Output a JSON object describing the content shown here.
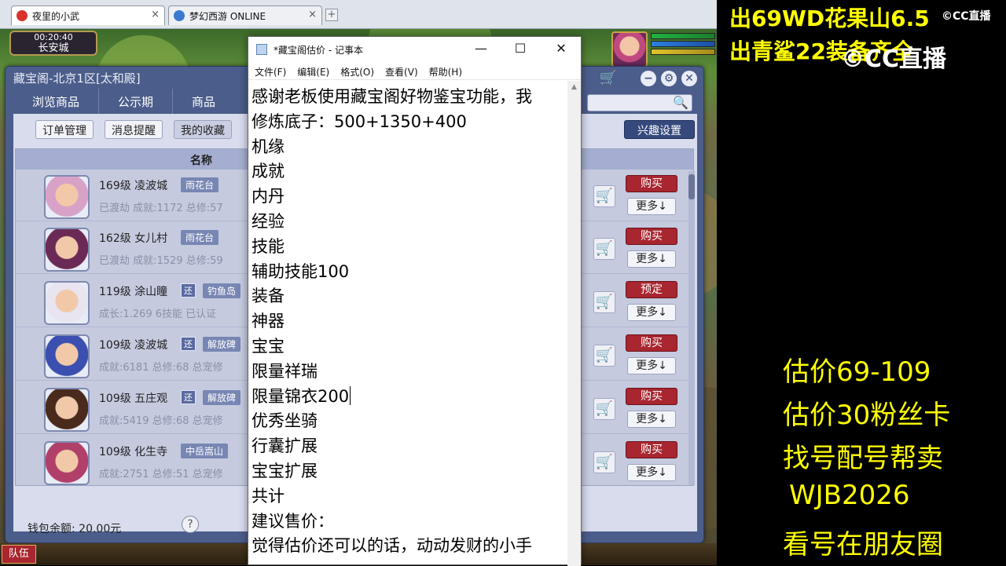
{
  "browser": {
    "tabs": [
      {
        "label": "夜里的小武",
        "active": true
      },
      {
        "label": "梦幻西游 ONLINE",
        "active": false
      }
    ],
    "new_tab": "+",
    "close": "×"
  },
  "game": {
    "time": "00:20:40",
    "location": "长安城",
    "team_button": "队伍"
  },
  "cbg": {
    "title": "藏宝阁-北京1区[太和殿]",
    "nav": [
      "浏览商品",
      "公示期",
      "商品"
    ],
    "controls": [
      "−",
      "⚙",
      "✕"
    ],
    "sub_buttons": [
      "订单管理",
      "消息提醒",
      "我的收藏"
    ],
    "interest_button": "兴趣设置",
    "list_header": "名称",
    "rows": [
      {
        "level": "169级 凌波城",
        "tag": "雨花台",
        "huan": "",
        "sub": "已渡劫 成就:1172 总修:57",
        "action": "购买",
        "more": "更多↓",
        "hair": "#d8a2c8"
      },
      {
        "level": "162级 女儿村",
        "tag": "雨花台",
        "huan": "",
        "sub": "已渡劫 成就:1529 总修:59",
        "action": "购买",
        "more": "更多↓",
        "hair": "#6b2a55"
      },
      {
        "level": "119级 涂山瞳",
        "tag": "钓鱼岛",
        "huan": "还",
        "sub": "成长:1.269 6技能 已认证",
        "action": "预定",
        "more": "更多↓",
        "hair": "#e8e4f0"
      },
      {
        "level": "109级 凌波城",
        "tag": "解放碑",
        "huan": "还",
        "sub": "成就:6181 总修:68 总宠修",
        "action": "购买",
        "more": "更多↓",
        "hair": "#3b4fb0"
      },
      {
        "level": "109级 五庄观",
        "tag": "解放碑",
        "huan": "还",
        "sub": "成就:5419 总修:68 总宠修",
        "action": "购买",
        "more": "更多↓",
        "hair": "#4a2a1c"
      },
      {
        "level": "109级 化生寺",
        "tag": "中岳嵩山",
        "huan": "",
        "sub": "成就:2751 总修:51 总宠修",
        "action": "购买",
        "more": "更多↓",
        "hair": "#b0406a"
      }
    ],
    "wallet": "钱包余额: 20.00元",
    "help": "?"
  },
  "notepad": {
    "title": "*藏宝阁估价 - 记事本",
    "menu": [
      "文件(F)",
      "编辑(E)",
      "格式(O)",
      "查看(V)",
      "帮助(H)"
    ],
    "window_buttons": [
      "—",
      "☐",
      "✕"
    ],
    "lines": [
      "感谢老板使用藏宝阁好物鉴宝功能，我",
      "修炼底子：500+1350+400",
      "机缘",
      "成就",
      "内丹",
      "经验",
      "技能",
      "辅助技能100",
      "装备",
      "神器",
      "宝宝",
      "限量祥瑞",
      "限量锦衣200",
      "优秀坐骑",
      "行囊扩展",
      "宝宝扩展",
      "共计",
      "建议售价：",
      "觉得估价还可以的话，动动发财的小手"
    ],
    "caret_line": 12
  },
  "overlay": {
    "top_lines": [
      "出69WD花果山6.5",
      "出青鲨22装备齐全"
    ],
    "logo_small": "©CC直播",
    "logo_big": "©CC直播",
    "lines": [
      "估价69-109",
      "估价30粉丝卡",
      "找号配号帮卖",
      "WJB2026",
      "看号在朋友圈"
    ],
    "text_color": "#ffff00"
  }
}
